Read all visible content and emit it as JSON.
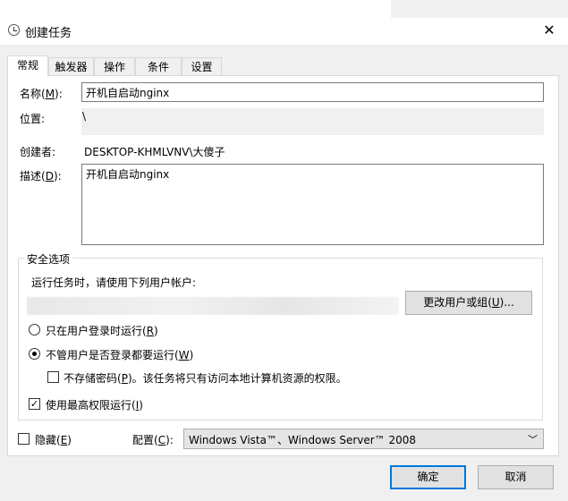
{
  "window": {
    "title": "创建任务",
    "close": "✕"
  },
  "tabs": [
    "常规",
    "触发器",
    "操作",
    "条件",
    "设置"
  ],
  "general": {
    "name_label_pre": "名称(",
    "name_label_key": "M",
    "name_label_post": "):",
    "name_value": "开机自启动nginx",
    "location_label": "位置:",
    "location_value": "\\",
    "author_label": "创建者:",
    "author_value": "DESKTOP-KHMLVNV\\大傻子",
    "desc_label_pre": "描述(",
    "desc_label_key": "D",
    "desc_label_post": "):",
    "desc_value": "开机自启动nginx"
  },
  "security": {
    "group_title": "安全选项",
    "run_as_label": "运行任务时，请使用下列用户帐户:",
    "change_user_pre": "更改用户或组(",
    "change_user_key": "U",
    "change_user_post": ")...",
    "opt_logged_on_pre": "只在用户登录时运行(",
    "opt_logged_on_key": "R",
    "opt_logged_on_post": ")",
    "opt_whether_pre": "不管用户是否登录都要运行(",
    "opt_whether_key": "W",
    "opt_whether_post": ")",
    "selected_option": "whether",
    "no_store_pre": "不存储密码(",
    "no_store_key": "P",
    "no_store_post": ")。该任务将只有访问本地计算机资源的权限。",
    "no_store_checked": false,
    "highest_pre": "使用最高权限运行(",
    "highest_key": "I",
    "highest_post": ")",
    "highest_checked": true
  },
  "footer": {
    "hidden_pre": "隐藏(",
    "hidden_key": "E",
    "hidden_post": ")",
    "configure_pre": "配置(",
    "configure_key": "C",
    "configure_post": "):",
    "configure_value": "Windows Vista™、Windows Server™ 2008",
    "ok": "确定",
    "cancel": "取消"
  }
}
